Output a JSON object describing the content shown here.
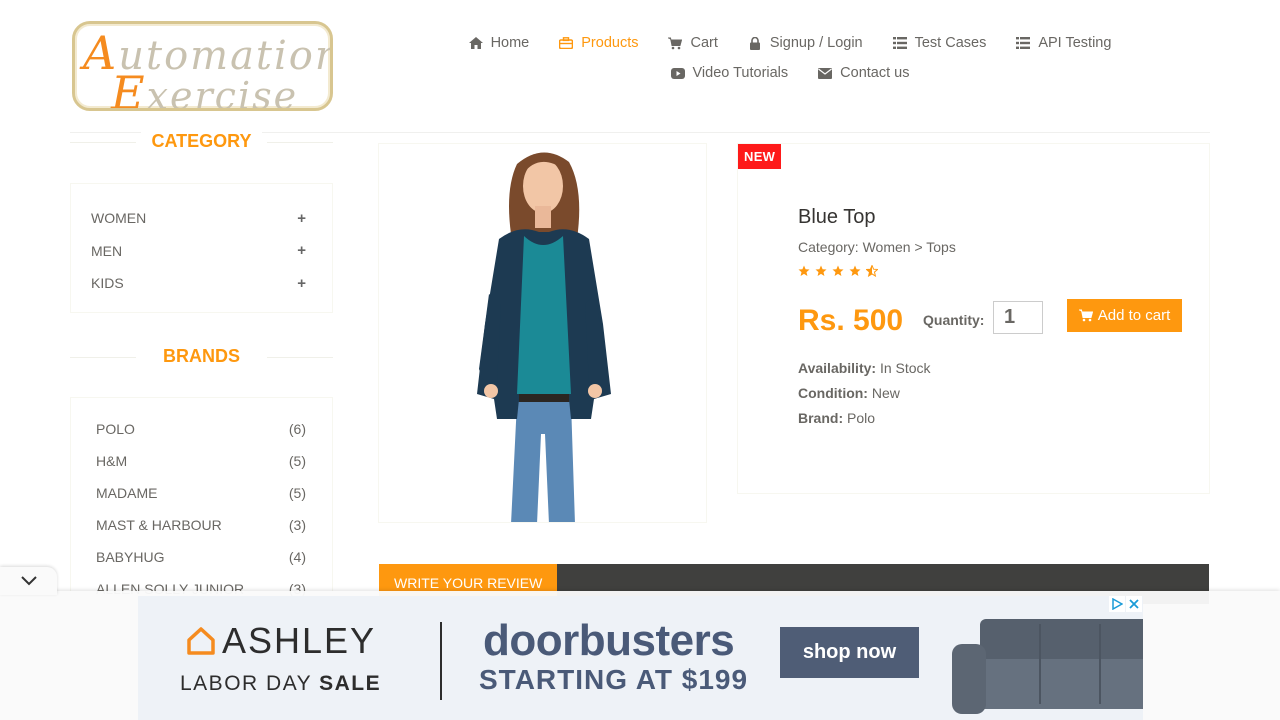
{
  "logo": {
    "line1_cap": "A",
    "line1_rest": "utomation",
    "line2_cap": "E",
    "line2_rest": "xercise"
  },
  "nav": {
    "items": [
      {
        "label": "Home",
        "icon": "home-icon"
      },
      {
        "label": "Products",
        "icon": "briefcase-icon",
        "active": true
      },
      {
        "label": "Cart",
        "icon": "cart-icon"
      },
      {
        "label": "Signup / Login",
        "icon": "lock-icon"
      },
      {
        "label": "Test Cases",
        "icon": "list-icon"
      },
      {
        "label": "API Testing",
        "icon": "list-icon"
      },
      {
        "label": "Video Tutorials",
        "icon": "youtube-play-icon"
      },
      {
        "label": "Contact us",
        "icon": "envelope-icon"
      }
    ]
  },
  "sidebar": {
    "category_title": "CATEGORY",
    "categories": [
      {
        "label": "WOMEN",
        "toggle": "+"
      },
      {
        "label": "MEN",
        "toggle": "+"
      },
      {
        "label": "KIDS",
        "toggle": "+"
      }
    ],
    "brands_title": "BRANDS",
    "brands": [
      {
        "name": "POLO",
        "count": "(6)"
      },
      {
        "name": "H&M",
        "count": "(5)"
      },
      {
        "name": "MADAME",
        "count": "(5)"
      },
      {
        "name": "MAST & HARBOUR",
        "count": "(3)"
      },
      {
        "name": "BABYHUG",
        "count": "(4)"
      },
      {
        "name": "ALLEN SOLLY JUNIOR",
        "count": "(3)"
      }
    ]
  },
  "product": {
    "badge": "NEW",
    "name": "Blue Top",
    "category": "Category: Women > Tops",
    "rating": 4.5,
    "price": "Rs. 500",
    "quantity_label": "Quantity:",
    "quantity_value": "1",
    "add_to_cart": "Add to cart",
    "availability_label": "Availability:",
    "availability": "In Stock",
    "condition_label": "Condition:",
    "condition": "New",
    "brand_label": "Brand:",
    "brand": "Polo"
  },
  "review": {
    "tab_label": "WRITE YOUR REVIEW"
  },
  "ad": {
    "brand": "ASHLEY",
    "sub_prefix": "LABOR DAY ",
    "sub_bold": "SALE",
    "headline": "doorbusters",
    "starting": "STARTING AT $199",
    "cta": "shop now"
  },
  "colors": {
    "accent": "#fe980f",
    "badge_red": "#fe1a1a",
    "review_bar": "#40403e",
    "ad_blue": "#4a5a78"
  }
}
